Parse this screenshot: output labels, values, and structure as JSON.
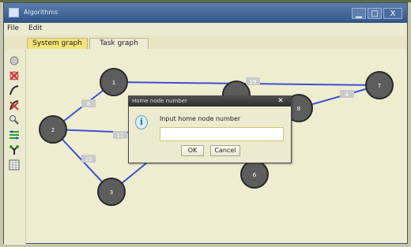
{
  "window": {
    "title": "Algorithms",
    "minimize_label": "▁",
    "maximize_label": "□",
    "close_label": "X"
  },
  "menu": {
    "items": [
      "File",
      "Edit"
    ]
  },
  "tabs": [
    {
      "label": "System graph",
      "active": true
    },
    {
      "label": "Task graph",
      "active": false
    }
  ],
  "toolbar": {
    "tools": [
      "circle-icon",
      "delete-node-icon",
      "edge-icon",
      "delete-edge-icon",
      "zoom-icon",
      "layout-icon",
      "tree-icon",
      "table-icon"
    ]
  },
  "graph": {
    "nodes": [
      {
        "id": "1"
      },
      {
        "id": "2"
      },
      {
        "id": "3"
      },
      {
        "id": "6"
      },
      {
        "id": "8"
      },
      {
        "id": "7"
      }
    ],
    "edge_weights": [
      "19",
      "4",
      "8",
      "11",
      "12"
    ]
  },
  "dialog": {
    "title": "Home node number",
    "close_label": "✕",
    "prompt": "Input home node number",
    "input_value": "",
    "ok_label": "OK",
    "cancel_label": "Cancel"
  },
  "colors": {
    "active_tab": "#f3e476",
    "edge": "#3d4fd8",
    "node": "#5d5d5d",
    "titlebar": "#2f5488"
  }
}
